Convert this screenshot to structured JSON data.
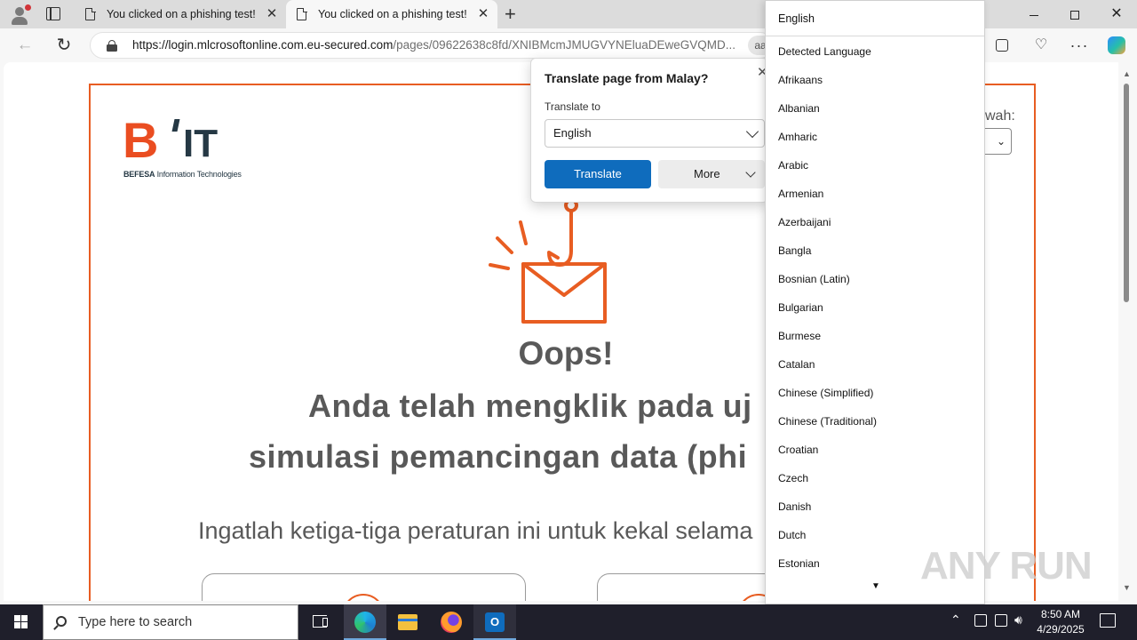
{
  "browser": {
    "tabs": [
      {
        "title": "You clicked on a phishing test!"
      },
      {
        "title": "You clicked on a phishing test!"
      }
    ],
    "url_domain": "https://login.mlcrosoftonline.com.eu-secured.com",
    "url_path": "/pages/09622638c8fd/XNIBMcmJMUGVYNEluaDEweGVQMD...",
    "read_aloud_label": "aa",
    "more_glyph": "···"
  },
  "page": {
    "logo": {
      "letter_b": "B",
      "letters_it": "IT",
      "company": "BEFESA",
      "tagline": " Information Technologies"
    },
    "language_hint": "wah:",
    "oops": "Oops!",
    "message_line1": "Anda telah mengklik pada uj",
    "message_line2": "simulasi pemancingan data (phi",
    "rules_intro": "Ingatlah ketiga-tiga peraturan ini untuk kekal selama"
  },
  "translate_popup": {
    "title": "Translate page from Malay?",
    "translate_to_label": "Translate to",
    "selected_language": "English",
    "translate_button": "Translate",
    "more_button": "More"
  },
  "language_dropdown": {
    "header": "English",
    "items": [
      "Detected Language",
      "Afrikaans",
      "Albanian",
      "Amharic",
      "Arabic",
      "Armenian",
      "Azerbaijani",
      "Bangla",
      "Bosnian (Latin)",
      "Bulgarian",
      "Burmese",
      "Catalan",
      "Chinese (Simplified)",
      "Chinese (Traditional)",
      "Croatian",
      "Czech",
      "Danish",
      "Dutch",
      "Estonian"
    ]
  },
  "watermark": "ANY RUN",
  "taskbar": {
    "search_placeholder": "Type here to search",
    "time": "8:50 AM",
    "date": "4/29/2025"
  },
  "colors": {
    "accent_orange": "#e85d22",
    "translate_blue": "#0f6cbd",
    "logo_dark": "#253844"
  }
}
